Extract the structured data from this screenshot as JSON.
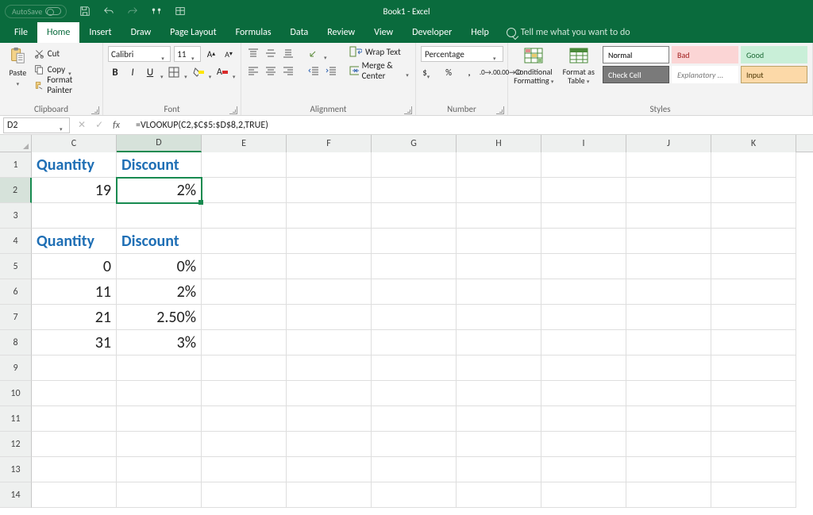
{
  "titlebar": {
    "autosave_label": "AutoSave",
    "title": "Book1 - Excel"
  },
  "ribbon": {
    "tabs": [
      "File",
      "Home",
      "Insert",
      "Draw",
      "Page Layout",
      "Formulas",
      "Data",
      "Review",
      "View",
      "Developer",
      "Help"
    ],
    "active_tab": "Home",
    "tell_me": "Tell me what you want to do"
  },
  "clipboard": {
    "paste": "Paste",
    "cut": "Cut",
    "copy": "Copy",
    "format_painter": "Format Painter",
    "group_label": "Clipboard"
  },
  "font": {
    "name": "Calibri",
    "size": "11",
    "group_label": "Font"
  },
  "alignment": {
    "wrap": "Wrap Text",
    "merge": "Merge & Center",
    "group_label": "Alignment"
  },
  "number": {
    "format": "Percentage",
    "group_label": "Number"
  },
  "styles": {
    "cond": "Conditional Formatting",
    "table": "Format as Table",
    "gallery": [
      {
        "label": "Normal",
        "bg": "#ffffff",
        "fg": "#000000",
        "border": "#808080"
      },
      {
        "label": "Bad",
        "bg": "#fbd5d5",
        "fg": "#a11f1f",
        "border": "#fbd5d5"
      },
      {
        "label": "Good",
        "bg": "#c9efd8",
        "fg": "#1d6b36",
        "border": "#c9efd8"
      },
      {
        "label": "Check Cell",
        "bg": "#7a7a7a",
        "fg": "#ffffff",
        "border": "#555555"
      },
      {
        "label": "Explanatory ...",
        "bg": "#ffffff",
        "fg": "#7a7a7a",
        "border": "#ffffff",
        "italic": true
      },
      {
        "label": "Input",
        "bg": "#fcd9a8",
        "fg": "#4a3300",
        "border": "#bba268"
      }
    ],
    "group_label": "Styles"
  },
  "formula_bar": {
    "cell_ref": "D2",
    "formula": "=VLOOKUP(C2,$C$5:$D$8,2,TRUE)"
  },
  "worksheet": {
    "column_letters": [
      "C",
      "D",
      "E",
      "F",
      "G",
      "H",
      "I",
      "J",
      "K"
    ],
    "row_numbers": [
      "1",
      "2",
      "3",
      "4",
      "5",
      "6",
      "7",
      "8",
      "9",
      "10",
      "11",
      "12",
      "13",
      "14"
    ],
    "selected_col_index": 1,
    "selected_row_index": 1,
    "data": {
      "C1": {
        "text": "Quantity",
        "hdr": true,
        "align": "left"
      },
      "D1": {
        "text": "Discount",
        "hdr": true,
        "align": "left"
      },
      "C2": {
        "text": "19"
      },
      "D2": {
        "text": "2%",
        "selected": true
      },
      "C4": {
        "text": "Quantity",
        "hdr": true,
        "align": "left"
      },
      "D4": {
        "text": "Discount",
        "hdr": true,
        "align": "left"
      },
      "C5": {
        "text": "0"
      },
      "D5": {
        "text": "0%"
      },
      "C6": {
        "text": "11"
      },
      "D6": {
        "text": "2%"
      },
      "C7": {
        "text": "21"
      },
      "D7": {
        "text": "2.50%"
      },
      "C8": {
        "text": "31"
      },
      "D8": {
        "text": "3%"
      }
    }
  }
}
